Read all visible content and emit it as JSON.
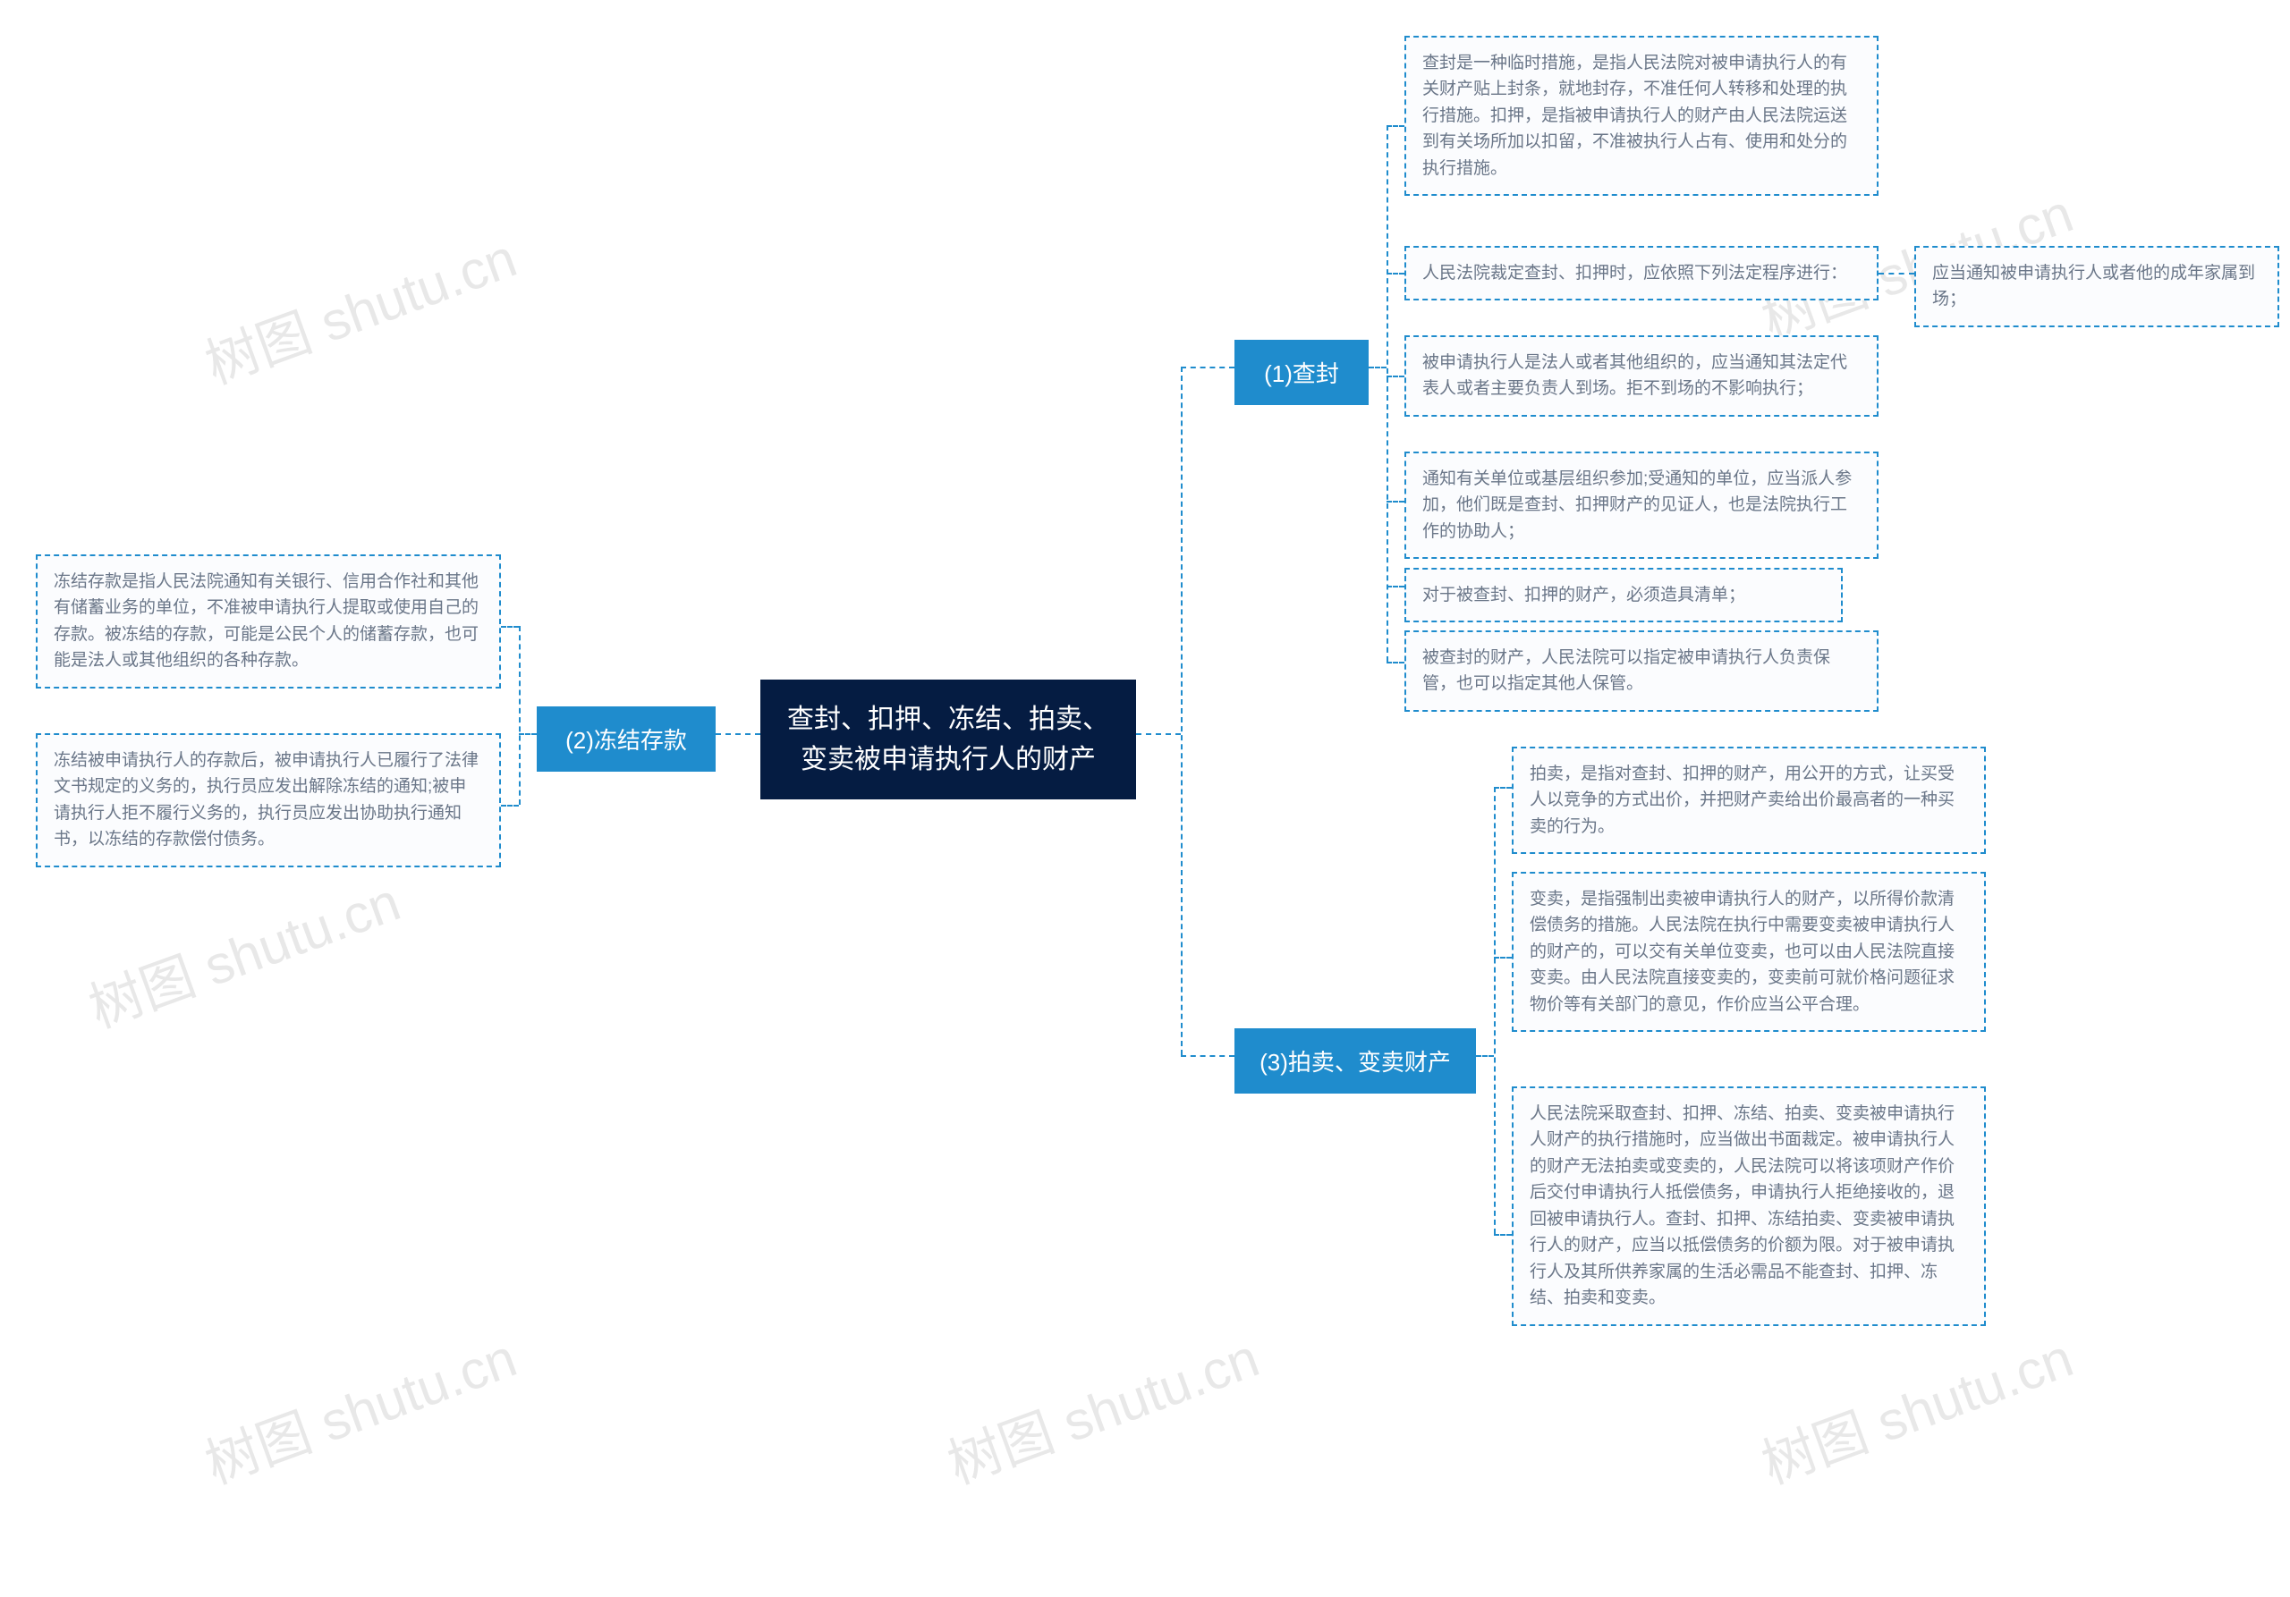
{
  "watermarks": [
    "树图 shutu.cn",
    "树图 shutu.cn",
    "树图 shutu.cn",
    "树图 shutu.cn",
    "树图 shutu.cn",
    "树图 shutu.cn"
  ],
  "center": "查封、扣押、冻结、拍卖、变卖被申请执行人的财产",
  "branch1": {
    "label": "(1)查封",
    "leaves": [
      "查封是一种临时措施，是指人民法院对被申请执行人的有关财产贴上封条，就地封存，不准任何人转移和处理的执行措施。扣押，是指被申请执行人的财产由人民法院运送到有关场所加以扣留，不准被执行人占有、使用和处分的执行措施。",
      "人民法院裁定查封、扣押时，应依照下列法定程序进行：",
      "被申请执行人是法人或者其他组织的，应当通知其法定代表人或者主要负责人到场。拒不到场的不影响执行；",
      "通知有关单位或基层组织参加;受通知的单位，应当派人参加，他们既是查封、扣押财产的见证人，也是法院执行工作的协助人；",
      "对于被查封、扣押的财产，必须造具清单；",
      "被查封的财产，人民法院可以指定被申请执行人负责保管，也可以指定其他人保管。"
    ],
    "leaf2_sub": "应当通知被申请执行人或者他的成年家属到场；"
  },
  "branch2": {
    "label": "(2)冻结存款",
    "leaves": [
      "冻结存款是指人民法院通知有关银行、信用合作社和其他有储蓄业务的单位，不准被申请执行人提取或使用自己的存款。被冻结的存款，可能是公民个人的储蓄存款，也可能是法人或其他组织的各种存款。",
      "冻结被申请执行人的存款后，被申请执行人已履行了法律文书规定的义务的，执行员应发出解除冻结的通知;被申请执行人拒不履行义务的，执行员应发出协助执行通知书，以冻结的存款偿付债务。"
    ]
  },
  "branch3": {
    "label": "(3)拍卖、变卖财产",
    "leaves": [
      "拍卖，是指对查封、扣押的财产，用公开的方式，让买受人以竞争的方式出价，并把财产卖给出价最高者的一种买卖的行为。",
      "变卖，是指强制出卖被申请执行人的财产，以所得价款清偿债务的措施。人民法院在执行中需要变卖被申请执行人的财产的，可以交有关单位变卖，也可以由人民法院直接变卖。由人民法院直接变卖的，变卖前可就价格问题征求物价等有关部门的意见，作价应当公平合理。",
      "人民法院采取查封、扣押、冻结、拍卖、变卖被申请执行人财产的执行措施时，应当做出书面裁定。被申请执行人的财产无法拍卖或变卖的，人民法院可以将该项财产作价后交付申请执行人抵偿债务，申请执行人拒绝接收的，退回被申请执行人。查封、扣押、冻结拍卖、变卖被申请执行人的财产，应当以抵偿债务的价额为限。对于被申请执行人及其所供养家属的生活必需品不能查封、扣押、冻结、拍卖和变卖。"
    ]
  }
}
